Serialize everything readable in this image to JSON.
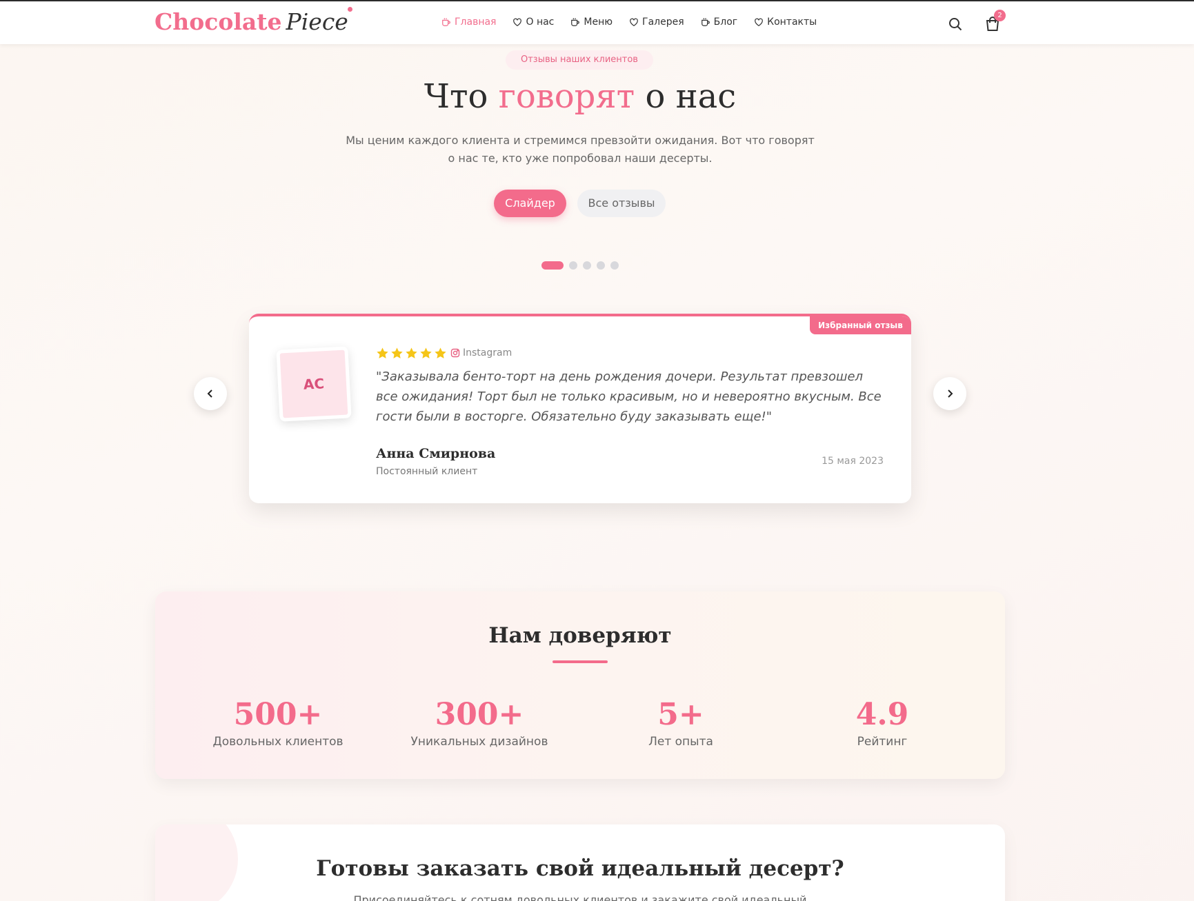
{
  "header": {
    "logo_main": "Chocolate",
    "logo_accent": "Piece",
    "nav": [
      {
        "label": "Главная",
        "icon": "cup-icon"
      },
      {
        "label": "О нас",
        "icon": "heart-icon"
      },
      {
        "label": "Меню",
        "icon": "cup-icon"
      },
      {
        "label": "Галерея",
        "icon": "heart-icon"
      },
      {
        "label": "Блог",
        "icon": "cup-icon"
      },
      {
        "label": "Контакты",
        "icon": "heart-icon"
      }
    ],
    "cart_count": "2"
  },
  "hero": {
    "eyebrow": "Отзывы наших клиентов",
    "title_before": "Что",
    "title_accent": "говорят",
    "title_after": "о нас",
    "subtitle": "Мы ценим каждого клиента и стремимся превзойти ожидания. Вот что говорят о нас те, кто уже попробовал наши десерты.",
    "tab_slider": "Слайдер",
    "tab_all": "Все отзывы",
    "slides_total": 5,
    "slide_active": 1
  },
  "review": {
    "badge": "Избранный отзыв",
    "initials": "АС",
    "rating": 5,
    "source": "Instagram",
    "quote": "\"Заказывала бенто-торт на день рождения дочери. Результат превзошел все ожидания! Торт был не только красивым, но и невероятно вкусным. Все гости были в восторге. Обязательно буду заказывать еще!\"",
    "author": "Анна Смирнова",
    "role": "Постоянный клиент",
    "date": "15 мая 2023"
  },
  "stats": {
    "title": "Нам доверяют",
    "items": [
      {
        "value": "500+",
        "label": "Довольных клиентов"
      },
      {
        "value": "300+",
        "label": "Уникальных дизайнов"
      },
      {
        "value": "5+",
        "label": "Лет опыта"
      },
      {
        "value": "4.9",
        "label": "Рейтинг"
      }
    ]
  },
  "cta": {
    "title": "Готовы заказать свой идеальный десерт?",
    "subtitle": "Присоединяйтесь к сотням довольных клиентов и закажите свой идеальный"
  },
  "colors": {
    "accent": "#f36b8b",
    "star": "#f5c518",
    "text": "#2d2d2d"
  }
}
